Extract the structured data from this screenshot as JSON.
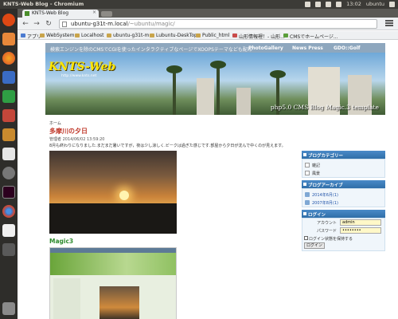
{
  "top_panel": {
    "window_title": "KNTS-Web Blog - Chromium",
    "clock": "13:02",
    "user": "ubuntu"
  },
  "launcher": {
    "icons": [
      "ubuntu-logo",
      "home-folder",
      "firefox",
      "libreoffice-writer",
      "libreoffice-calc",
      "libreoffice-impress",
      "software-center",
      "amazon",
      "settings",
      "terminal",
      "chromium",
      "gedit",
      "trash"
    ]
  },
  "browser": {
    "tab_title": "KNTS-Web Blog",
    "omnibox_host": "ubuntu-g31t-m.local",
    "omnibox_path": "/~ubuntu/magic/",
    "bookmarks": [
      {
        "label": "アプリ",
        "kind": "app"
      },
      {
        "label": "WebSystem",
        "kind": "folder"
      },
      {
        "label": "Localhost",
        "kind": "folder"
      },
      {
        "label": "ubuntu-g31t-m",
        "kind": "folder"
      },
      {
        "label": "Lubuntu-DeskTop",
        "kind": "folder"
      },
      {
        "label": "Public_html",
        "kind": "folder"
      },
      {
        "label": "山形情報裡！- 山形...",
        "kind": "red"
      },
      {
        "label": "CMSでホームページ...",
        "kind": "green"
      }
    ]
  },
  "site": {
    "topnav_message": "検索エンジンを除のCMSでCGIを使ったインタラクティブなページでXOOPSテーマなども配布",
    "topnav_links": [
      "PhotoGallery",
      "News Press",
      "GDO::Golf"
    ],
    "logo": "KNTS-Web",
    "logo_sub": "http://www.knts.net",
    "banner_caption": "php5.0 CMS Blog Magic.3  template",
    "breadcrumb": "ホーム",
    "post": {
      "title": "多摩川の夕日",
      "meta": "管理者 2014/06/02 13:59:20",
      "text": "8月も終わりになりました.まだまだ暑いですが，夜は少し涼しく.ビークは過ぎた感じです.部屋から夕日が沈んで中くのが見えます。"
    },
    "post2_title": "Magic3",
    "sidebar": {
      "category_head": "ブログカテゴリー",
      "categories": [
        "雑記",
        "風景"
      ],
      "archive_head": "ブログアーカイブ",
      "archives": [
        "2014年6月(1)",
        "2007年8月(1)"
      ],
      "login_head": "ログイン",
      "account_label": "アカウント",
      "account_value": "admin",
      "password_label": "パスワード",
      "password_value": "••••••••",
      "remember_label": "ログイン状態を保持する",
      "login_button": "ログイン"
    }
  },
  "colors": {
    "accent_blue": "#2f6ea8",
    "post_title_red": "#c0392b",
    "post2_title_green": "#2e8b2e",
    "logo_yellow": "#ffe600"
  }
}
